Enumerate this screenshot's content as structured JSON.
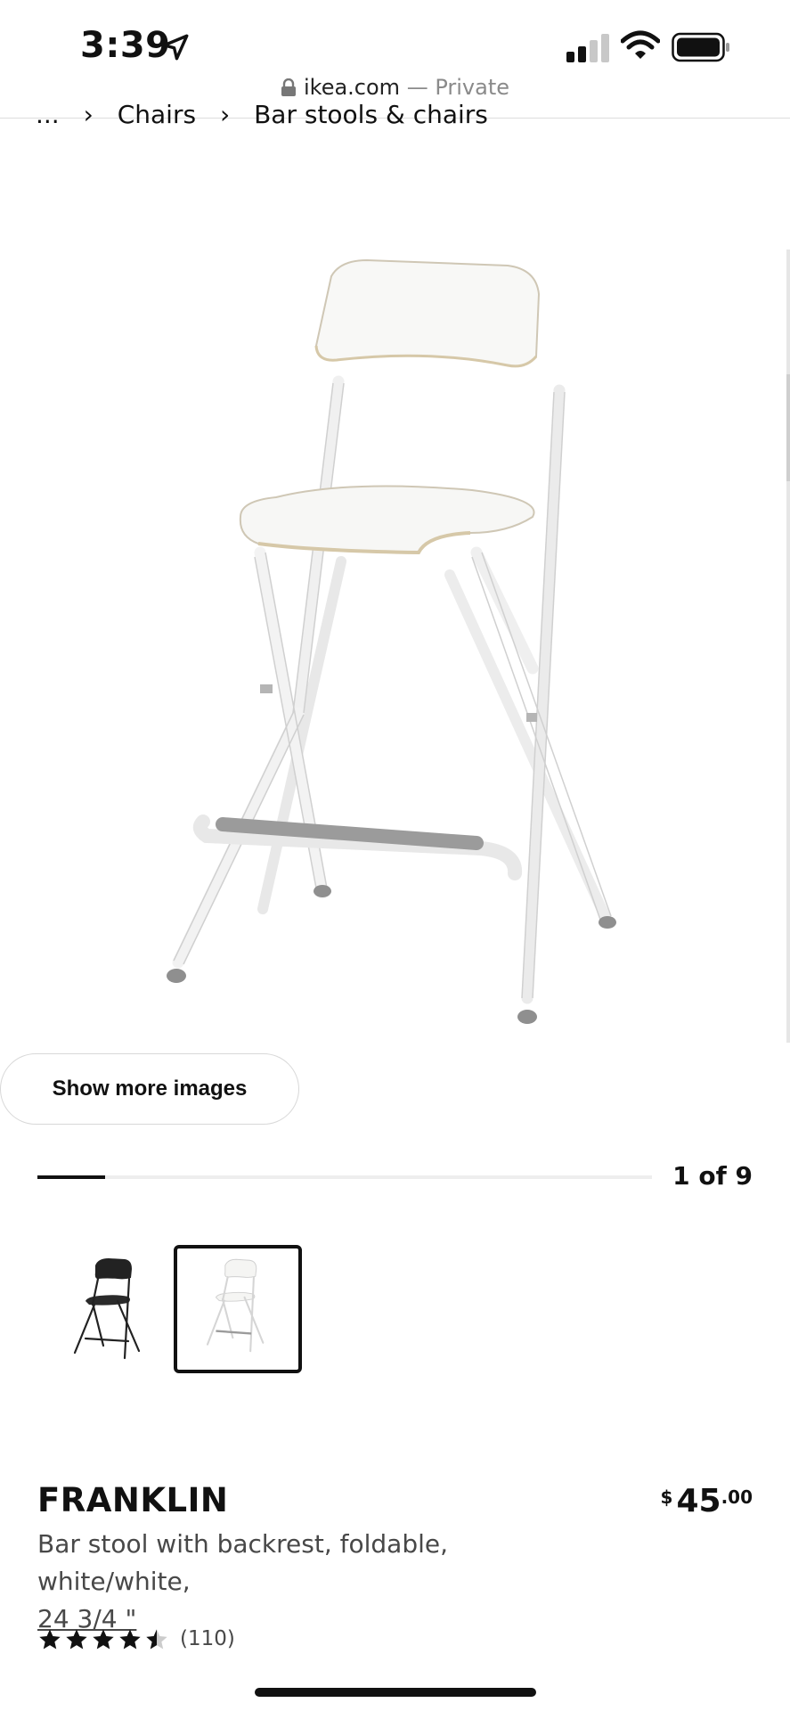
{
  "status": {
    "time": "3:39"
  },
  "address": {
    "domain": "ikea.com",
    "suffix": " — Private"
  },
  "breadcrumb": {
    "items": [
      "...",
      "Chairs",
      "Bar stools & chairs"
    ]
  },
  "gallery": {
    "show_more_label": "Show more images",
    "counter": "1 of 9",
    "progress": 0.11
  },
  "product": {
    "name": "FRANKLIN",
    "price_currency": "$",
    "price_integer": "45",
    "price_decimal": ".00",
    "description": "Bar stool with backrest, foldable, white/white,",
    "dimension": "24 3/4 \"",
    "rating": 4.5,
    "review_count": "(110)"
  },
  "colors": {
    "accent": "#111111",
    "frame_gray": "#9b9b9b"
  }
}
